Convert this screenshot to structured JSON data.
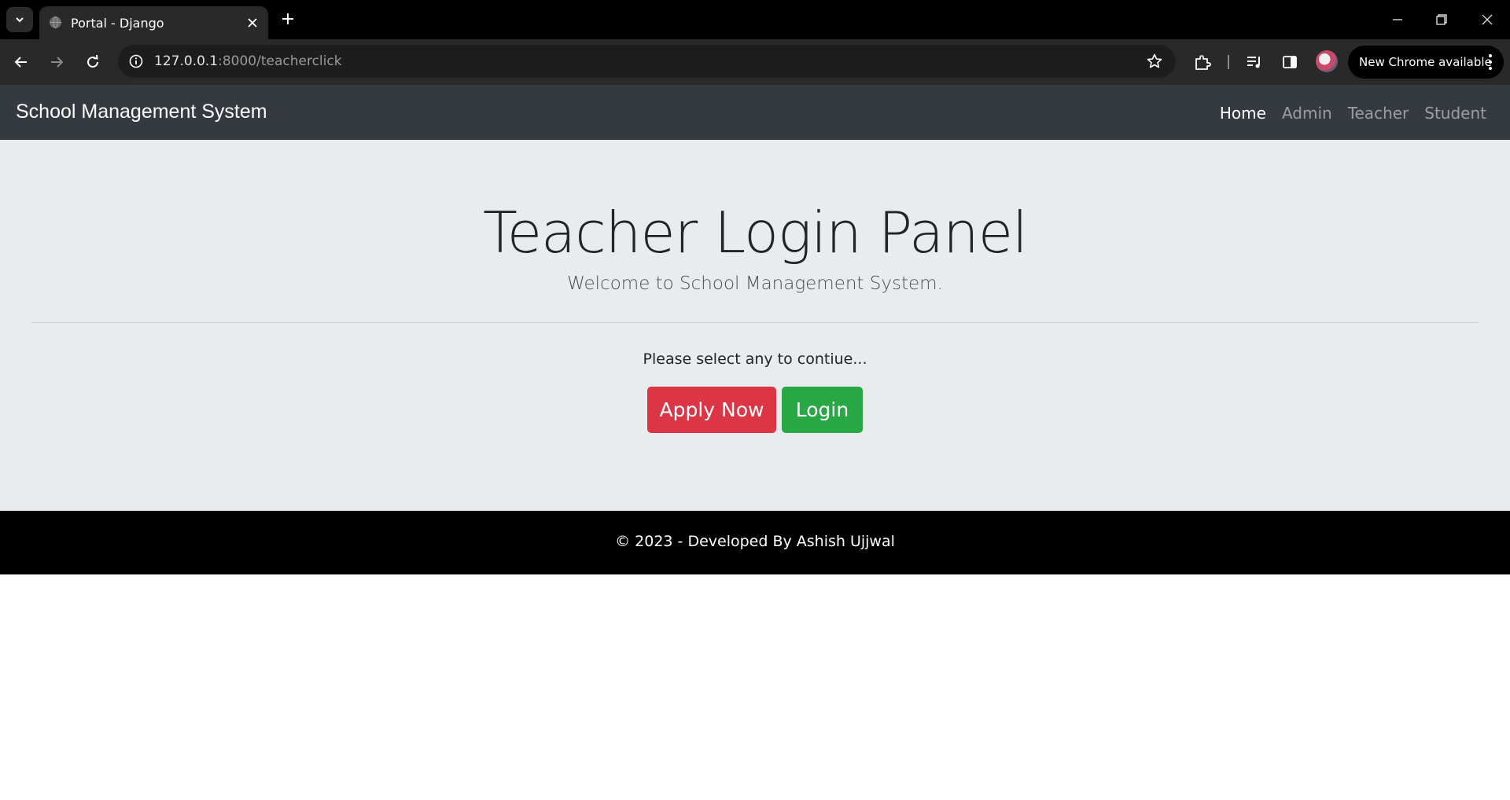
{
  "browser": {
    "tab_title": "Portal - Django",
    "url_host": "127.0.0.1",
    "url_path": ":8000/teacherclick",
    "update_button": "New Chrome available"
  },
  "navbar": {
    "brand": "School Management System",
    "links": [
      "Home",
      "Admin",
      "Teacher",
      "Student"
    ],
    "active_link": "Home"
  },
  "jumbotron": {
    "title": "Teacher Login Panel",
    "lead": "Welcome to School Management System.",
    "prompt": "Please select any to contiue...",
    "apply_button": "Apply Now",
    "login_button": "Login"
  },
  "footer": {
    "text": "© 2023 - Developed By Ashish Ujjwal"
  },
  "colors": {
    "navbar_bg": "#343a40",
    "jumbotron_bg": "#e9ecef",
    "danger": "#dc3545",
    "success": "#28a745",
    "footer_bg": "#000000"
  }
}
